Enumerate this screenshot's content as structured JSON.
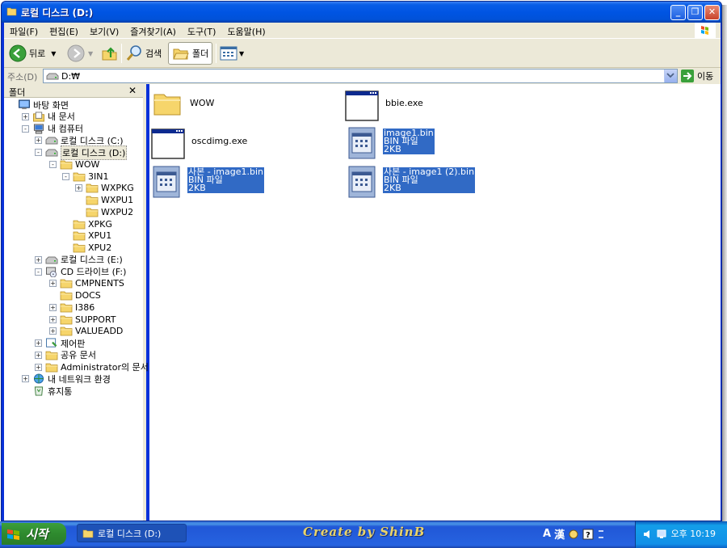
{
  "window": {
    "title": "로컬 디스크 (D:)",
    "minimize_glyph": "_",
    "restore_glyph": "❐",
    "close_glyph": "✕"
  },
  "menu": [
    "파일(F)",
    "편집(E)",
    "보기(V)",
    "즐겨찾기(A)",
    "도구(T)",
    "도움말(H)"
  ],
  "toolbar": {
    "back_label": "뒤로",
    "search_label": "검색",
    "folders_label": "폴더"
  },
  "address": {
    "label": "주소(D)",
    "value": "D:₩",
    "go_label": "이동"
  },
  "folder_pane": {
    "title": "폴더",
    "close_glyph": "✕",
    "tree": [
      {
        "label": "바탕 화면",
        "level": 0,
        "expander": "",
        "icon": "desktop-icon"
      },
      {
        "label": "내 문서",
        "level": 1,
        "expander": "+",
        "icon": "my-documents-icon"
      },
      {
        "label": "내 컴퓨터",
        "level": 1,
        "expander": "-",
        "icon": "my-computer-icon"
      },
      {
        "label": "로컬 디스크 (C:)",
        "level": 2,
        "expander": "+",
        "icon": "drive-icon"
      },
      {
        "label": "로컬 디스크 (D:)",
        "level": 2,
        "expander": "-",
        "icon": "drive-icon",
        "selected": true
      },
      {
        "label": "WOW",
        "level": 3,
        "expander": "-",
        "icon": "folder-icon"
      },
      {
        "label": "3IN1",
        "level": 4,
        "expander": "-",
        "icon": "folder-icon"
      },
      {
        "label": "WXPKG",
        "level": 5,
        "expander": "+",
        "icon": "folder-icon"
      },
      {
        "label": "WXPU1",
        "level": 5,
        "expander": "",
        "icon": "folder-icon"
      },
      {
        "label": "WXPU2",
        "level": 5,
        "expander": "",
        "icon": "folder-icon"
      },
      {
        "label": "XPKG",
        "level": 4,
        "expander": "",
        "icon": "folder-icon"
      },
      {
        "label": "XPU1",
        "level": 4,
        "expander": "",
        "icon": "folder-icon"
      },
      {
        "label": "XPU2",
        "level": 4,
        "expander": "",
        "icon": "folder-icon"
      },
      {
        "label": "로컬 디스크 (E:)",
        "level": 2,
        "expander": "+",
        "icon": "drive-icon"
      },
      {
        "label": "CD 드라이브 (F:)",
        "level": 2,
        "expander": "-",
        "icon": "cd-drive-icon"
      },
      {
        "label": "CMPNENTS",
        "level": 3,
        "expander": "+",
        "icon": "folder-icon"
      },
      {
        "label": "DOCS",
        "level": 3,
        "expander": "",
        "icon": "folder-icon"
      },
      {
        "label": "I386",
        "level": 3,
        "expander": "+",
        "icon": "folder-icon"
      },
      {
        "label": "SUPPORT",
        "level": 3,
        "expander": "+",
        "icon": "folder-icon"
      },
      {
        "label": "VALUEADD",
        "level": 3,
        "expander": "+",
        "icon": "folder-icon"
      },
      {
        "label": "제어판",
        "level": 2,
        "expander": "+",
        "icon": "control-panel-icon"
      },
      {
        "label": "공유 문서",
        "level": 2,
        "expander": "+",
        "icon": "folder-icon"
      },
      {
        "label": "Administrator의 문서",
        "level": 2,
        "expander": "+",
        "icon": "folder-icon"
      },
      {
        "label": "내 네트워크 환경",
        "level": 1,
        "expander": "+",
        "icon": "network-icon"
      },
      {
        "label": "휴지통",
        "level": 1,
        "expander": "",
        "icon": "recycle-bin-icon"
      }
    ]
  },
  "files": [
    {
      "lines": [
        "WOW"
      ],
      "icon": "folder-icon",
      "selected": false
    },
    {
      "lines": [
        "bbie.exe"
      ],
      "icon": "exe-window-icon",
      "selected": false
    },
    {
      "lines": [
        "oscdimg.exe"
      ],
      "icon": "exe-window-icon",
      "selected": false
    },
    {
      "lines": [
        "image1.bin",
        "BIN 파일",
        "2KB"
      ],
      "icon": "bin-file-icon",
      "selected": true
    },
    {
      "lines": [
        "사본 - image1.bin",
        "BIN 파일",
        "2KB"
      ],
      "icon": "bin-file-icon",
      "selected": true
    },
    {
      "lines": [
        "사본 - image1 (2).bin",
        "BIN 파일",
        "2KB"
      ],
      "icon": "bin-file-icon",
      "selected": true
    }
  ],
  "taskbar": {
    "start_label": "시작",
    "window_label": "로컬 디스크 (D:)",
    "watermark": "Create by ShinB",
    "lang_a": "A",
    "lang_han": "漢",
    "clock": "오후 10:19"
  },
  "colors": {
    "title_blue": "#0054e3",
    "selection": "#316ac5",
    "chrome": "#ece9d8",
    "start_green": "#3c9f3c"
  }
}
